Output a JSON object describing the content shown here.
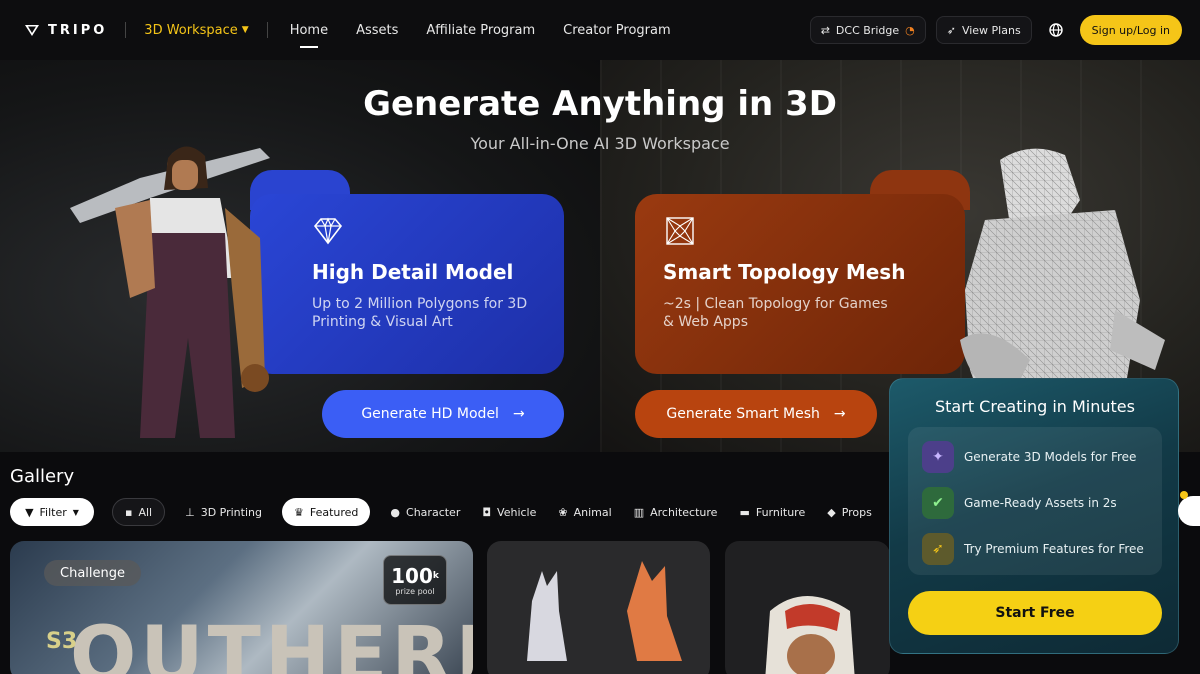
{
  "nav": {
    "brand": "TRIPO",
    "workspace": "3D Workspace",
    "links": [
      "Home",
      "Assets",
      "Affiliate Program",
      "Creator Program"
    ],
    "dcc_bridge": "DCC Bridge",
    "view_plans": "View Plans",
    "signup": "Sign up/Log in"
  },
  "hero": {
    "title": "Generate Anything in 3D",
    "subtitle": "Your All-in-One AI 3D Workspace",
    "cards": [
      {
        "title": "High Detail Model",
        "desc": "Up to 2 Million Polygons for 3D Printing & Visual Art",
        "cta": "Generate HD Model",
        "icon": "diamond-icon"
      },
      {
        "title": "Smart Topology Mesh",
        "desc": "~2s | Clean Topology for Games & Web Apps",
        "cta": "Generate Smart Mesh",
        "icon": "mesh-icon"
      }
    ]
  },
  "gallery": {
    "title": "Gallery",
    "filters": [
      "Filter",
      "All",
      "3D Printing",
      "Featured",
      "Character",
      "Vehicle",
      "Animal",
      "Architecture",
      "Furniture",
      "Props"
    ],
    "tile1": {
      "badge": "Challenge",
      "prize_number": "100",
      "prize_unit": "k",
      "prize_label": "prize pool",
      "season": "S3",
      "word": "OUTHERE"
    }
  },
  "popup": {
    "title": "Start Creating in Minutes",
    "items": [
      "Generate 3D Models for Free",
      "Game-Ready Assets in 2s",
      "Try Premium Features for Free"
    ],
    "cta": "Start Free"
  },
  "colors": {
    "accent": "#f5c518",
    "blue_card": "#2a46d6",
    "orange_card": "#9a3a10",
    "popup_bg": "#123a47"
  }
}
